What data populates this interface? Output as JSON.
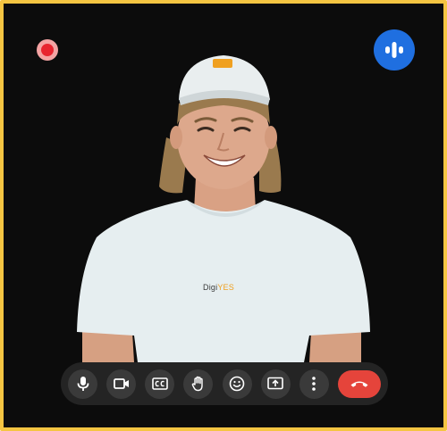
{
  "call": {
    "recording_active": true,
    "participant_speaking": true,
    "shirt_logo_text": "Digi",
    "shirt_logo_accent": "YES"
  },
  "colors": {
    "frame_border": "#f5c542",
    "recording": "#e8242f",
    "speaking": "#1f6fe0",
    "end_call": "#e5443b",
    "toolbar_bg": "#242424",
    "button_bg": "#3a3a3a"
  },
  "toolbar": {
    "buttons": [
      {
        "icon": "microphone-icon"
      },
      {
        "icon": "camera-icon"
      },
      {
        "icon": "captions-icon"
      },
      {
        "icon": "raise-hand-icon"
      },
      {
        "icon": "emoji-icon"
      },
      {
        "icon": "present-screen-icon"
      },
      {
        "icon": "more-options-icon"
      },
      {
        "icon": "end-call-icon"
      }
    ]
  }
}
